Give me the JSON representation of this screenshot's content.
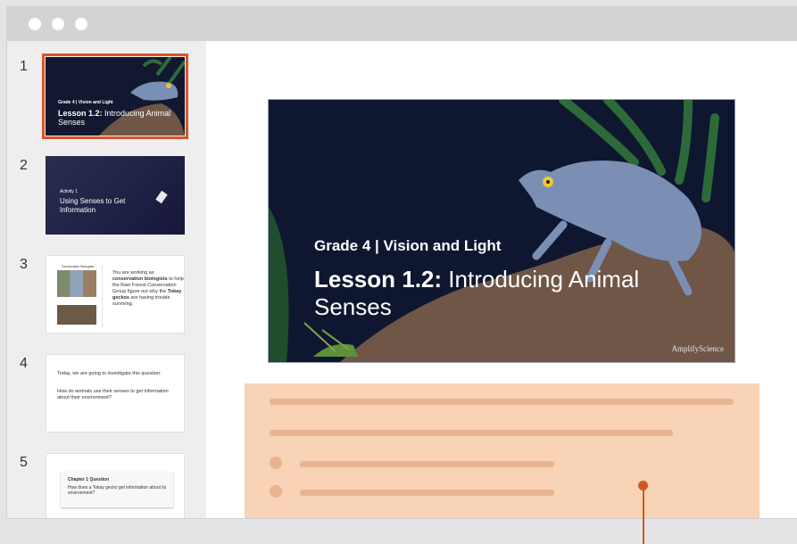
{
  "window": {
    "controls": [
      "close",
      "minimize",
      "maximize"
    ]
  },
  "sidebar": {
    "thumbnails": [
      {
        "number": "1",
        "grade": "Grade 4 | Vision and Light",
        "lesson_prefix": "Lesson 1.2:",
        "lesson_title": "Introducing Animal Senses"
      },
      {
        "number": "2",
        "label": "Activity 1",
        "title": "Using Senses to Get Information"
      },
      {
        "number": "3",
        "heading": "Conservation Biologists",
        "text_1": "You are working as",
        "bold_1": "conservation biologists",
        "text_2": "to help the Rain Forest Conservation Group figure out why the",
        "bold_2": "Tokay geckos",
        "text_3": "are having trouble surviving."
      },
      {
        "number": "4",
        "intro": "Today, we are going to investigate this question:",
        "question": "How do animals use their senses to get information about their environment?"
      },
      {
        "number": "5",
        "heading": "Chapter 1 Question",
        "question": "How does a Tokay gecko get information about its environment?"
      }
    ]
  },
  "slide": {
    "grade_line": "Grade 4 | Vision and Light",
    "lesson_prefix": "Lesson 1.2:",
    "lesson_title_line1": "Introducing Animal",
    "lesson_title_line2": "Senses",
    "brand": "AmplifyScience"
  },
  "notes": {
    "highlight_color": "#f8d3b5",
    "pointer_color": "#cf5a1f"
  }
}
